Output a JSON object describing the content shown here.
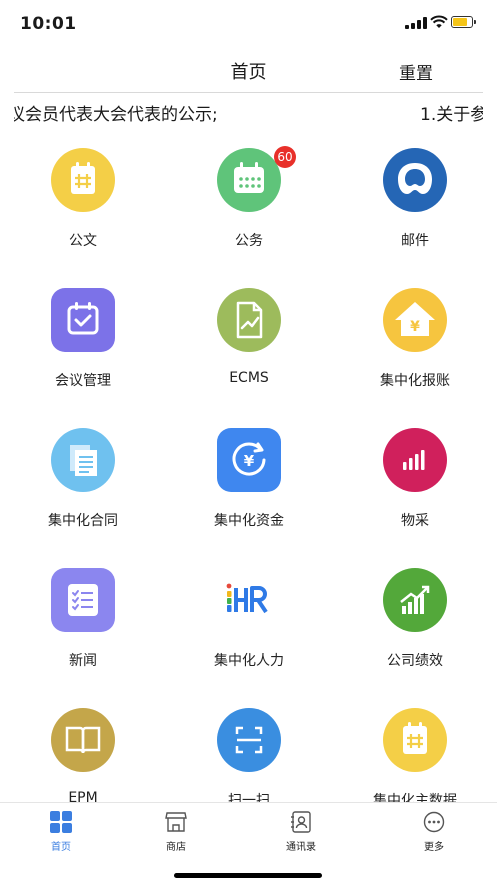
{
  "status": {
    "time": "10:01"
  },
  "nav": {
    "title": "首页",
    "reset_label": "重置"
  },
  "marquee": {
    "left_text": "议会员代表大会代表的公示;",
    "right_text": "1.关于参"
  },
  "tiles": [
    {
      "label": "公文",
      "icon": "document-icon",
      "color": "#f4cf47"
    },
    {
      "label": "公务",
      "icon": "calendar-icon",
      "color": "#5fc47a",
      "badge": "60"
    },
    {
      "label": "邮件",
      "icon": "mail-icon",
      "color": "#2566b5"
    },
    {
      "label": "会议管理",
      "icon": "meeting-icon",
      "color": "#7c72e8"
    },
    {
      "label": "ECMS",
      "icon": "ecms-icon",
      "color": "#9dbb5c"
    },
    {
      "label": "集中化报账",
      "icon": "reimburse-icon",
      "color": "#f6c53f"
    },
    {
      "label": "集中化合同",
      "icon": "contract-icon",
      "color": "#6fc1ef"
    },
    {
      "label": "集中化资金",
      "icon": "funds-icon",
      "color": "#3f87ef"
    },
    {
      "label": "物采",
      "icon": "procurement-icon",
      "color": "#d0205c"
    },
    {
      "label": "新闻",
      "icon": "news-icon",
      "color": "#8b86ef"
    },
    {
      "label": "集中化人力",
      "icon": "ihr-logo-icon",
      "color": "#ffffff"
    },
    {
      "label": "公司绩效",
      "icon": "performance-icon",
      "color": "#53a83a"
    },
    {
      "label": "EPM",
      "icon": "book-icon",
      "color": "#c4a64a"
    },
    {
      "label": "扫一扫",
      "icon": "scan-icon",
      "color": "#3a8ee0"
    },
    {
      "label": "集中化主数据",
      "icon": "master-data-icon",
      "color": "#f4cf47"
    }
  ],
  "tabbar": {
    "items": [
      {
        "label": "首页",
        "icon": "grid-icon",
        "active": true
      },
      {
        "label": "商店",
        "icon": "store-icon"
      },
      {
        "label": "通讯录",
        "icon": "contacts-icon"
      },
      {
        "label": "更多",
        "icon": "more-icon"
      }
    ],
    "active_color": "#3b7ee0"
  }
}
